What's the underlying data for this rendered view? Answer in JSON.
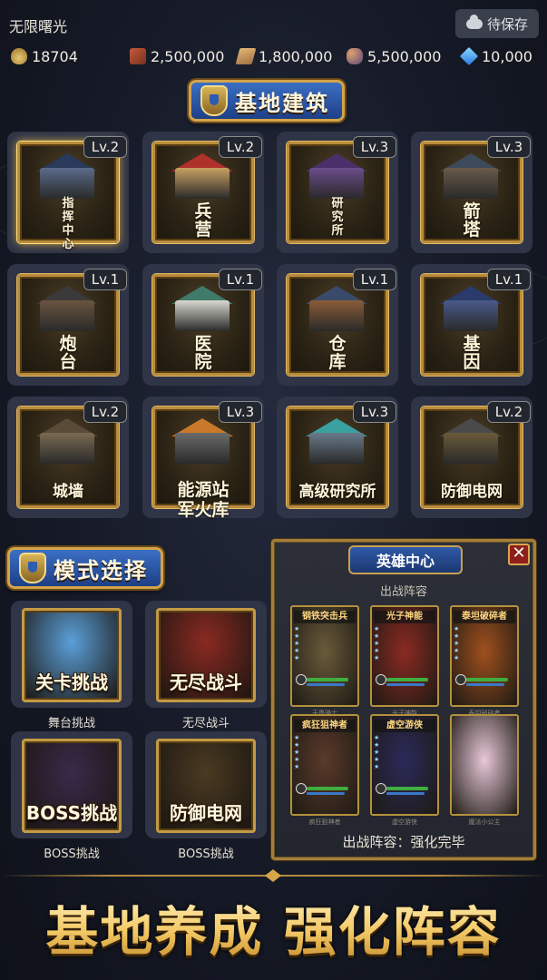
{
  "header": {
    "game_title": "无限曙光",
    "save_label": "待保存",
    "resources": [
      {
        "icon": "money-bag-icon",
        "value": "18704"
      },
      {
        "icon": "wood-icon",
        "value": "2,500,000"
      },
      {
        "icon": "plank-icon",
        "value": "1,800,000"
      },
      {
        "icon": "ore-icon",
        "value": "5,500,000"
      },
      {
        "icon": "diamond-icon",
        "value": "10,000"
      }
    ]
  },
  "buildings_section": {
    "title": "基地建筑",
    "items": [
      {
        "name": "指\n挥\n中\n心",
        "level": "Lv.2",
        "color": "#5a6b8a",
        "roof": "#2a3a5a"
      },
      {
        "name": "兵\n营",
        "level": "Lv.2",
        "color": "#c9a062",
        "roof": "#b0302a"
      },
      {
        "name": "研\n究\n所",
        "level": "Lv.3",
        "color": "#6a4c8a",
        "roof": "#4a2f6b"
      },
      {
        "name": "箭\n塔",
        "level": "Lv.3",
        "color": "#6a5a4a",
        "roof": "#3d4a5a"
      },
      {
        "name": "炮\n台",
        "level": "Lv.1",
        "color": "#6a5440",
        "roof": "#3a3a3a"
      },
      {
        "name": "医\n院",
        "level": "Lv.1",
        "color": "#d8d8d0",
        "roof": "#3f7a6a"
      },
      {
        "name": "仓\n库",
        "level": "Lv.1",
        "color": "#8a5c38",
        "roof": "#3a4a6a"
      },
      {
        "name": "基\n因",
        "level": "Lv.1",
        "color": "#4a5a8a",
        "roof": "#2a3a6a"
      },
      {
        "name": "城墙",
        "level": "Lv.2",
        "color": "#7a6a52",
        "roof": "#5a4a38"
      },
      {
        "name": "能源站\n军火库",
        "level": "Lv.3",
        "color": "#6a6a6a",
        "roof": "#c87a2a"
      },
      {
        "name": "高级研究所",
        "level": "Lv.3",
        "color": "#6a7a8a",
        "roof": "#3aa0a0"
      },
      {
        "name": "防御电网",
        "level": "Lv.2",
        "color": "#6a5a3a",
        "roof": "#4a4a4a"
      }
    ]
  },
  "modes_section": {
    "title": "模式选择",
    "items": [
      {
        "title": "关卡挑战",
        "caption": "舞台挑战",
        "bg": "#5b9fd8"
      },
      {
        "title": "无尽战斗",
        "caption": "无尽战斗",
        "bg": "#8a2a22"
      },
      {
        "title": "BOSS挑战",
        "caption": "BOSS挑战",
        "bg": "#3a2a4a"
      },
      {
        "title": "防御电网",
        "caption": "BOSS挑战",
        "bg": "#4a3a22"
      }
    ]
  },
  "hero_center": {
    "title": "英雄中心",
    "close_label": "✕",
    "lineup_label": "出战阵容",
    "heroes": [
      {
        "name": "钢铁突击兵",
        "caption": "无畏骑士",
        "bg": "#6a5a3a"
      },
      {
        "name": "光子神能",
        "caption": "光子神能",
        "bg": "#8a2a22"
      },
      {
        "name": "泰坦破碎者",
        "caption": "泰坦破碎者",
        "bg": "#a0501e"
      },
      {
        "name": "疯狂狙神者",
        "caption": "疯狂狙神者",
        "bg": "#5a3a2a"
      },
      {
        "name": "虚空游侠",
        "caption": "虚空游侠",
        "bg": "#2a2a5a"
      },
      {
        "name": "",
        "caption": "魔法小公主",
        "bg": "#e8c8d8"
      }
    ],
    "footer": "出战阵容：强化完毕"
  },
  "tagline": "基地养成 强化阵容"
}
